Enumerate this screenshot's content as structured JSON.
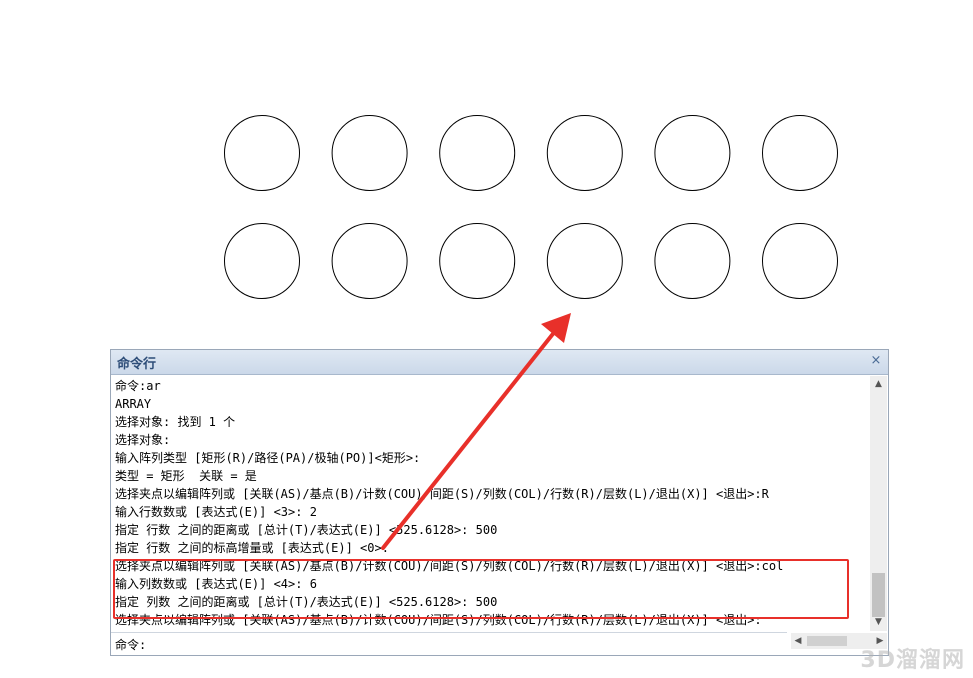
{
  "panel": {
    "title": "命令行",
    "close_glyph": "×"
  },
  "history": [
    "命令:ar",
    "ARRAY",
    "选择对象: 找到 1 个",
    "选择对象:",
    "输入阵列类型 [矩形(R)/路径(PA)/极轴(PO)]<矩形>:",
    "类型 = 矩形  关联 = 是",
    "选择夹点以编辑阵列或 [关联(AS)/基点(B)/计数(COU)/间距(S)/列数(COL)/行数(R)/层数(L)/退出(X)] <退出>:R",
    "输入行数数或 [表达式(E)] <3>: 2",
    "指定 行数 之间的距离或 [总计(T)/表达式(E)] <525.6128>: 500",
    "指定 行数 之间的标高增量或 [表达式(E)] <0>:",
    "选择夹点以编辑阵列或 [关联(AS)/基点(B)/计数(COU)/间距(S)/列数(COL)/行数(R)/层数(L)/退出(X)] <退出>:col",
    "输入列数数或 [表达式(E)] <4>: 6",
    "指定 列数 之间的距离或 [总计(T)/表达式(E)] <525.6128>: 500",
    "选择夹点以编辑阵列或 [关联(AS)/基点(B)/计数(COU)/间距(S)/列数(COL)/行数(R)/层数(L)/退出(X)] <退出>:"
  ],
  "input": {
    "prompt": "命令:",
    "value": ""
  },
  "drawing": {
    "rows": 2,
    "columns": 6,
    "shape": "circle"
  },
  "icons": {
    "scroll_up": "▲",
    "scroll_down": "▼",
    "scroll_left": "◀",
    "scroll_right": "▶"
  },
  "colors": {
    "highlight": "#e8302a",
    "arrow": "#e8302a"
  },
  "watermark": "3D溜溜网"
}
